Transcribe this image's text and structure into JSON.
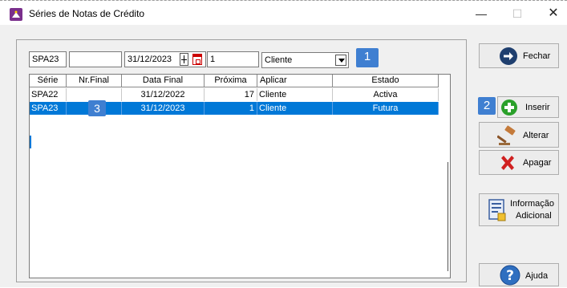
{
  "window": {
    "title": "Séries de Notas de Crédito",
    "controls": {
      "minimize": "—",
      "maximize": "☐",
      "close": "✕"
    }
  },
  "filters": {
    "serie_value": "SPA23",
    "nr_final_value": "",
    "data_final_value": "31/12/2023",
    "proxima_value": "1",
    "aplicar_selected": "Cliente"
  },
  "badges": {
    "b1": "1",
    "b2": "2",
    "b3": "3"
  },
  "grid": {
    "columns": [
      "Série",
      "Nr.Final",
      "Data Final",
      "Próxima",
      "Aplicar",
      "Estado"
    ],
    "rows": [
      {
        "serie": "SPA22",
        "nr_final": "",
        "data_final": "31/12/2022",
        "proxima": "17",
        "aplicar": "Cliente",
        "estado": "Activa",
        "selected": false
      },
      {
        "serie": "SPA23",
        "nr_final": "",
        "data_final": "31/12/2023",
        "proxima": "1",
        "aplicar": "Cliente",
        "estado": "Futura",
        "selected": true
      }
    ]
  },
  "buttons": {
    "fechar": "Fechar",
    "inserir": "Inserir",
    "alterar": "Alterar",
    "apagar": "Apagar",
    "info_line1": "Informação",
    "info_line2": "Adicional",
    "ajuda": "Ajuda"
  },
  "colors": {
    "selection": "#0078d7",
    "badge": "#3f7fd1",
    "fechar_icon": "#1f3f6f",
    "inserir_icon": "#2aa02a",
    "apagar_icon": "#d02020",
    "ajuda_icon": "#2f6fc0"
  },
  "icons": {
    "fechar": "arrow-right-circle-icon",
    "inserir": "plus-circle-icon",
    "alterar": "gavel-icon",
    "apagar": "red-x-icon",
    "info": "document-icon",
    "ajuda": "question-circle-icon"
  }
}
